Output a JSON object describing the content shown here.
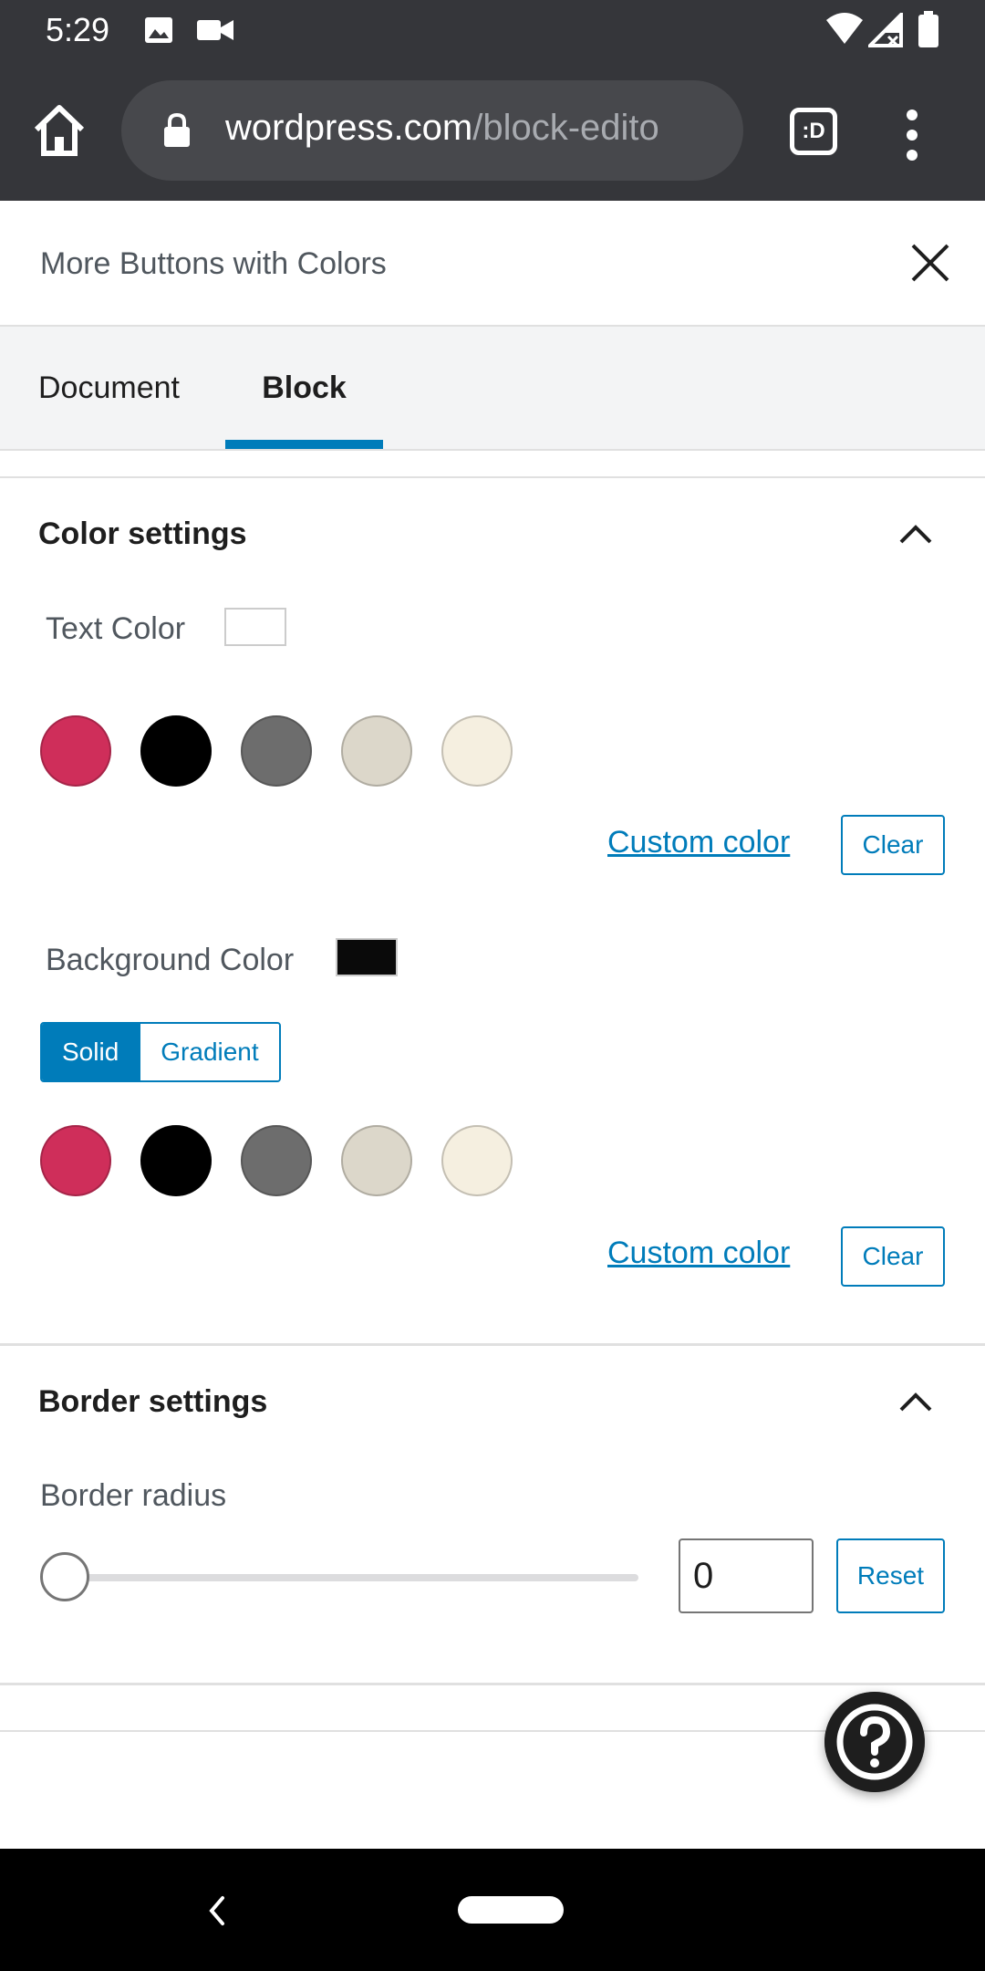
{
  "status_bar": {
    "time": "5:29",
    "icons": [
      "image-icon",
      "video-camera-icon",
      "wifi-icon",
      "signal-icon",
      "battery-icon"
    ]
  },
  "browser": {
    "url_host": "wordpress.com",
    "url_path": "/block-edito",
    "tab_switcher_label": ":D",
    "icons": [
      "home-icon",
      "lock-icon",
      "tab-switcher-icon",
      "more-vertical-icon"
    ]
  },
  "panel": {
    "title": "More Buttons with Colors",
    "close_icon": "close-icon"
  },
  "tabs": [
    {
      "label": "Document",
      "active": false
    },
    {
      "label": "Block",
      "active": true
    }
  ],
  "color_settings": {
    "title": "Color settings",
    "text_color": {
      "label": "Text Color",
      "current": "#ffffff",
      "palette": [
        "#cf2e5a",
        "#000000",
        "#6d6d6d",
        "#dcd7ca",
        "#f5efe0"
      ],
      "custom_color_label": "Custom color",
      "clear_label": "Clear"
    },
    "background_color": {
      "label": "Background Color",
      "current": "#0a0a0a",
      "mode_solid": "Solid",
      "mode_gradient": "Gradient",
      "selected_mode": "Solid",
      "palette": [
        "#cf2e5a",
        "#000000",
        "#6d6d6d",
        "#dcd7ca",
        "#f5efe0"
      ],
      "custom_color_label": "Custom color",
      "clear_label": "Clear"
    }
  },
  "border_settings": {
    "title": "Border settings",
    "radius_label": "Border radius",
    "radius_value": "0",
    "reset_label": "Reset"
  },
  "colors": {
    "accent": "#007cba",
    "chrome": "#35363a"
  },
  "help_icon": "help-icon"
}
